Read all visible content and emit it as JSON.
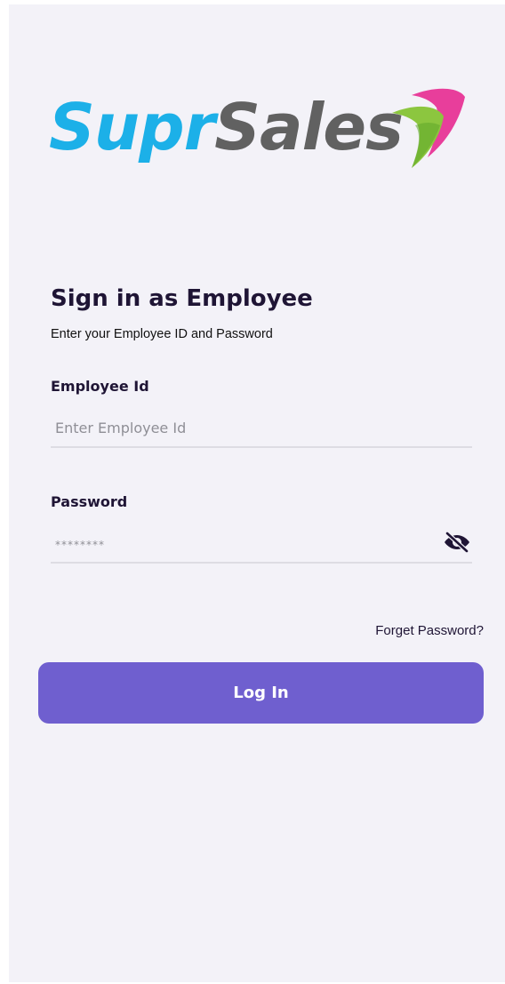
{
  "logo": {
    "part1": "Supr",
    "part2": "Sales"
  },
  "colors": {
    "brand_blue": "#1cb0e8",
    "brand_gray": "#616161",
    "accent_pink": "#e83e9b",
    "accent_green": "#8cc63f",
    "button_purple": "#6f5fcf",
    "background": "#f3f2f8"
  },
  "signin": {
    "title": "Sign in as Employee",
    "subtitle": "Enter your Employee ID and Password"
  },
  "employee_id": {
    "label": "Employee Id",
    "placeholder": "Enter Employee Id",
    "value": ""
  },
  "password": {
    "label": "Password",
    "placeholder": "********",
    "value": "",
    "visibility_icon": "eye-off-icon"
  },
  "links": {
    "forget_password": "Forget Password?"
  },
  "buttons": {
    "login": "Log In"
  }
}
